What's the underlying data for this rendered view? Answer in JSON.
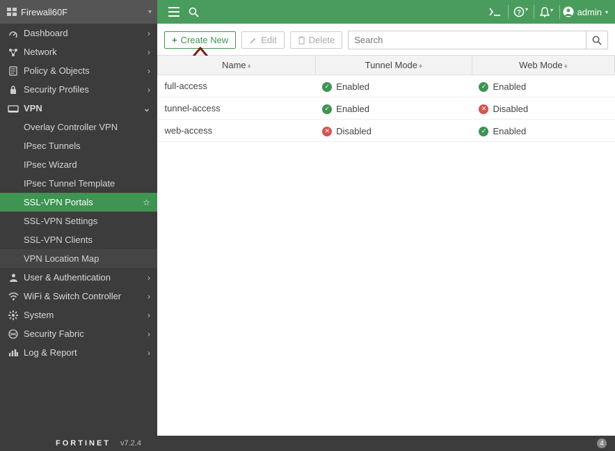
{
  "device_name": "Firewall60F",
  "brand": "FORTINET",
  "version": "v7.2.4",
  "footer_badge": "4",
  "topbar": {
    "admin_label": "admin"
  },
  "toolbar": {
    "create_label": "Create New",
    "edit_label": "Edit",
    "delete_label": "Delete",
    "search_placeholder": "Search"
  },
  "sidebar": {
    "items": [
      {
        "icon": "dashboard",
        "label": "Dashboard",
        "expandable": true
      },
      {
        "icon": "network",
        "label": "Network",
        "expandable": true
      },
      {
        "icon": "policy",
        "label": "Policy & Objects",
        "expandable": true
      },
      {
        "icon": "lock",
        "label": "Security Profiles",
        "expandable": true
      },
      {
        "icon": "vpn",
        "label": "VPN",
        "expandable": true,
        "open": true,
        "children": [
          {
            "label": "Overlay Controller VPN"
          },
          {
            "label": "IPsec Tunnels"
          },
          {
            "label": "IPsec Wizard"
          },
          {
            "label": "IPsec Tunnel Template"
          },
          {
            "label": "SSL-VPN Portals",
            "active": true,
            "star": true
          },
          {
            "label": "SSL-VPN Settings"
          },
          {
            "label": "SSL-VPN Clients"
          },
          {
            "label": "VPN Location Map",
            "highlight": true
          }
        ]
      },
      {
        "icon": "user",
        "label": "User & Authentication",
        "expandable": true
      },
      {
        "icon": "wifi",
        "label": "WiFi & Switch Controller",
        "expandable": true
      },
      {
        "icon": "gear",
        "label": "System",
        "expandable": true
      },
      {
        "icon": "fabric",
        "label": "Security Fabric",
        "expandable": true
      },
      {
        "icon": "log",
        "label": "Log & Report",
        "expandable": true
      }
    ]
  },
  "table": {
    "columns": [
      "Name",
      "Tunnel Mode",
      "Web Mode"
    ],
    "status_labels": {
      "enabled": "Enabled",
      "disabled": "Disabled"
    },
    "rows": [
      {
        "name": "full-access",
        "tunnel": true,
        "web": true
      },
      {
        "name": "tunnel-access",
        "tunnel": true,
        "web": false
      },
      {
        "name": "web-access",
        "tunnel": false,
        "web": true
      }
    ]
  }
}
